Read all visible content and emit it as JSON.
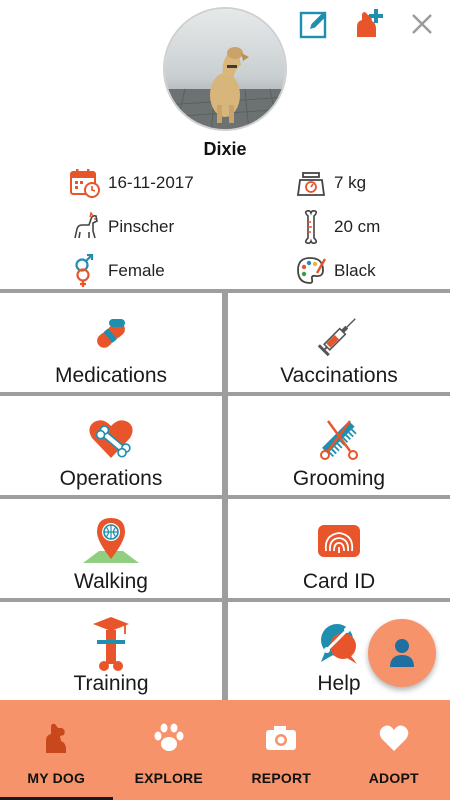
{
  "header": {
    "dog_name": "Dixie",
    "actions": [
      {
        "icon": "edit-icon"
      },
      {
        "icon": "add-dog-icon"
      },
      {
        "icon": "close-icon"
      }
    ]
  },
  "info": {
    "birthdate": "16-11-2017",
    "weight": "7 kg",
    "breed": "Pinscher",
    "height": "20 cm",
    "gender": "Female",
    "color": "Black"
  },
  "tiles": [
    {
      "label": "Medications",
      "icon": "pill-icon"
    },
    {
      "label": "Vaccinations",
      "icon": "syringe-icon"
    },
    {
      "label": "Operations",
      "icon": "heart-bone-icon"
    },
    {
      "label": "Grooming",
      "icon": "scissors-comb-icon"
    },
    {
      "label": "Walking",
      "icon": "map-pin-globe-icon"
    },
    {
      "label": "Card ID",
      "icon": "fingerprint-icon"
    },
    {
      "label": "Training",
      "icon": "graduation-bone-icon"
    },
    {
      "label": "Help",
      "icon": "help-chat-icon"
    }
  ],
  "bottom_nav": [
    {
      "label": "MY DOG",
      "icon": "dog-icon",
      "active": true
    },
    {
      "label": "EXPLORE",
      "icon": "paw-icon",
      "active": false
    },
    {
      "label": "REPORT",
      "icon": "camera-icon",
      "active": false
    },
    {
      "label": "ADOPT",
      "icon": "heart-icon",
      "active": false
    }
  ],
  "colors": {
    "accent": "#f6936a",
    "icon_orange": "#e8552a",
    "icon_teal": "#1f8fb0",
    "divider": "#9e9e9e"
  }
}
